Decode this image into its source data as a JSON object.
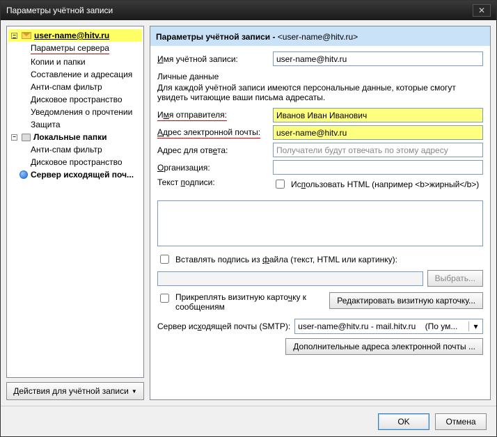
{
  "titlebar": {
    "title": "Параметры учётной записи"
  },
  "sidebar": {
    "account_email": "user-name@hitv.ru",
    "items": [
      "Параметры сервера",
      "Копии и папки",
      "Составление и адресация",
      "Анти-спам фильтр",
      "Дисковое пространство",
      "Уведомления о прочтении",
      "Защита"
    ],
    "local_folders": "Локальные папки",
    "local_items": [
      "Анти-спам фильтр",
      "Дисковое пространство"
    ],
    "smtp": "Сервер исходящей поч...",
    "actions_button": "Действия для учётной записи"
  },
  "main": {
    "header_prefix": "Параметры учётной записи - ",
    "header_email": "<user-name@hitv.ru>",
    "account_name_label": "Имя учётной записи:",
    "account_name_value": "user-name@hitv.ru",
    "personal_section": "Личные данные",
    "personal_desc": "Для каждой учётной записи имеются персональные данные, которые смогут увидеть читающие ваши письма адресаты.",
    "sender_name_label": "Имя отправителя:",
    "sender_name_value": "Иванов Иван Иванович",
    "email_label": "Адрес электронной почты:",
    "email_value": "user-name@hitv.ru",
    "reply_label": "Адрес для ответа:",
    "reply_placeholder": "Получатели будут отвечать по этому адресу",
    "org_label": "Организация:",
    "sig_label": "Текст подписи:",
    "sig_html_checkbox": "Использовать HTML (например <b>жирный</b>)",
    "sig_file_checkbox": "Вставлять подпись из файла (текст, HTML или картинку):",
    "browse_button": "Выбрать...",
    "vcard_checkbox": "Прикреплять визитную карточку к сообщениям",
    "vcard_button": "Редактировать визитную карточку...",
    "smtp_label": "Сервер исходящей почты (SMTP):",
    "smtp_value": "user-name@hitv.ru - mail.hitv.ru",
    "smtp_suffix": "(По ум...",
    "extra_addresses_button": "Дополнительные адреса электронной почты ..."
  },
  "footer": {
    "ok": "OK",
    "cancel": "Отмена"
  }
}
